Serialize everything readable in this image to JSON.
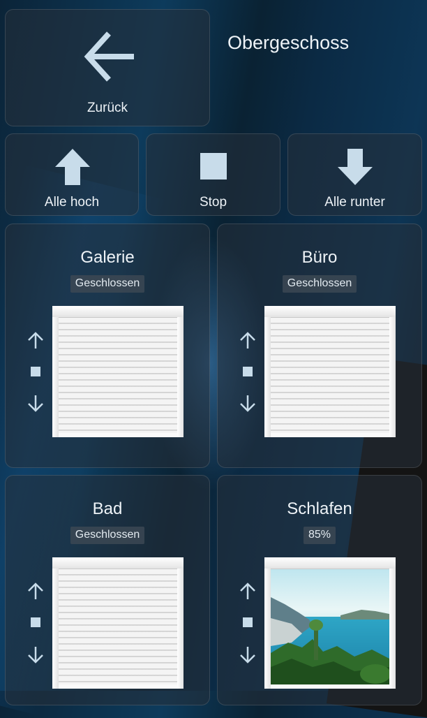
{
  "page_title": "Obergeschoss",
  "back_button": {
    "label": "Zurück",
    "icon": "arrow-left-icon"
  },
  "controls": {
    "all_up": {
      "label": "Alle hoch",
      "icon": "arrow-up-icon"
    },
    "stop": {
      "label": "Stop",
      "icon": "stop-square-icon"
    },
    "all_down": {
      "label": "Alle runter",
      "icon": "arrow-down-icon"
    }
  },
  "rooms": [
    {
      "name": "Galerie",
      "state": "Geschlossen",
      "position_percent": 0
    },
    {
      "name": "Büro",
      "state": "Geschlossen",
      "position_percent": 0
    },
    {
      "name": "Bad",
      "state": "Geschlossen",
      "position_percent": 0
    },
    {
      "name": "Schlafen",
      "state": "85%",
      "position_percent": 85
    }
  ],
  "colors": {
    "icon_color": "#c8dcea",
    "text_color": "#eef3f7",
    "card_bg": "#26303a"
  }
}
